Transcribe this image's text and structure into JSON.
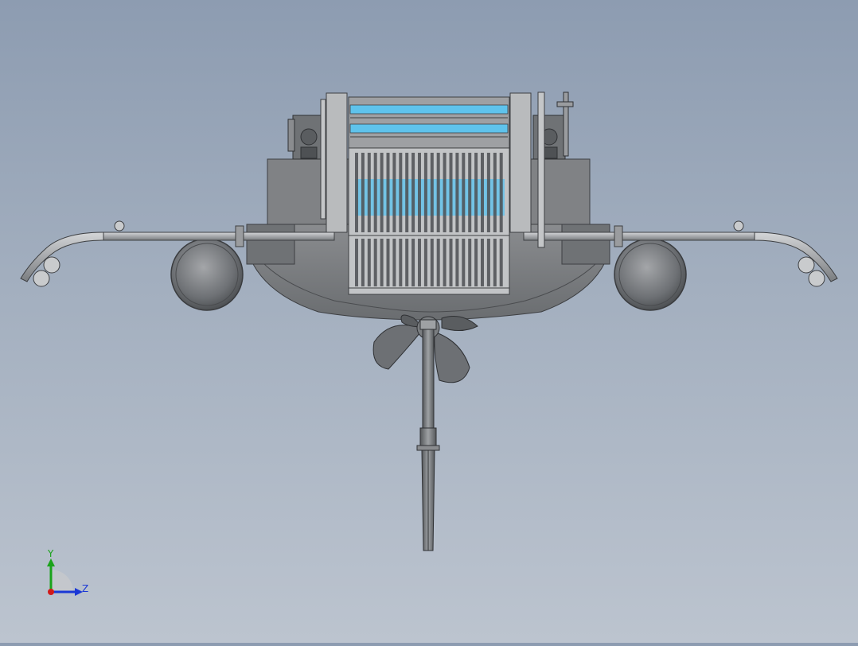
{
  "viewport": {
    "background_top": "#8d9cb1",
    "background_bottom": "#bcc4cf"
  },
  "model": {
    "body_color": "#7d7f82",
    "body_dark": "#5f6266",
    "frame_color": "#b9bbbd",
    "highlight_color": "#5fc3ec",
    "propeller_color": "#6d7074"
  },
  "triad": {
    "y_label": "Y",
    "z_label": "Z",
    "y_color": "#1aa31a",
    "z_color": "#1a37d6",
    "x_color": "#d11a1a"
  }
}
